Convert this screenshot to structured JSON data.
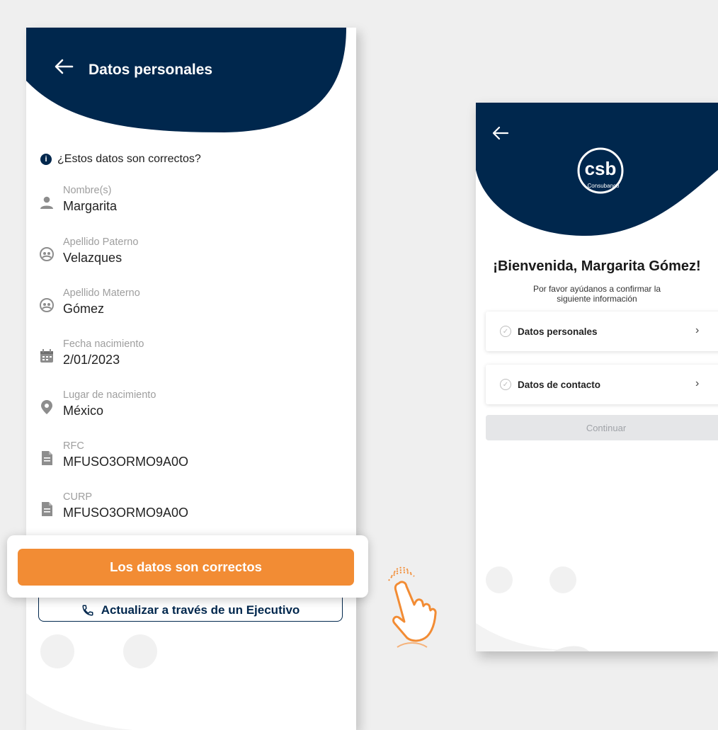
{
  "left_screen": {
    "title": "Datos personales",
    "question": "¿Estos datos son correctos?",
    "fields": [
      {
        "label": "Nombre(s)",
        "value": "Margarita",
        "icon": "person-icon"
      },
      {
        "label": "Apellido Paterno",
        "value": "Velazques",
        "icon": "people-icon"
      },
      {
        "label": "Apellido Materno",
        "value": "Gómez",
        "icon": "people-icon"
      },
      {
        "label": "Fecha nacimiento",
        "value": "2/01/2023",
        "icon": "calendar-icon"
      },
      {
        "label": "Lugar de nacimiento",
        "value": "México",
        "icon": "location-pin-icon"
      },
      {
        "label": "RFC",
        "value": "MFUSO3ORMO9A0O",
        "icon": "document-icon"
      },
      {
        "label": "CURP",
        "value": "MFUSO3ORMO9A0O",
        "icon": "document-icon"
      }
    ],
    "primary_button": "Los datos son correctos",
    "secondary_button": "Actualizar a través de un Ejecutivo"
  },
  "right_screen": {
    "logo_text": "csb",
    "logo_subtext": "Consubanco",
    "welcome_title": "¡Bienvenida, Margarita Gómez!",
    "subtitle": "Por favor ayúdanos a confirmar la siguiente información",
    "items": [
      {
        "label": "Datos personales"
      },
      {
        "label": "Datos de contacto"
      }
    ],
    "continue_button": "Continuar"
  },
  "colors": {
    "navy": "#00274d",
    "orange": "#f28c34",
    "background": "#efefef",
    "disabled": "#e5e6e8"
  }
}
